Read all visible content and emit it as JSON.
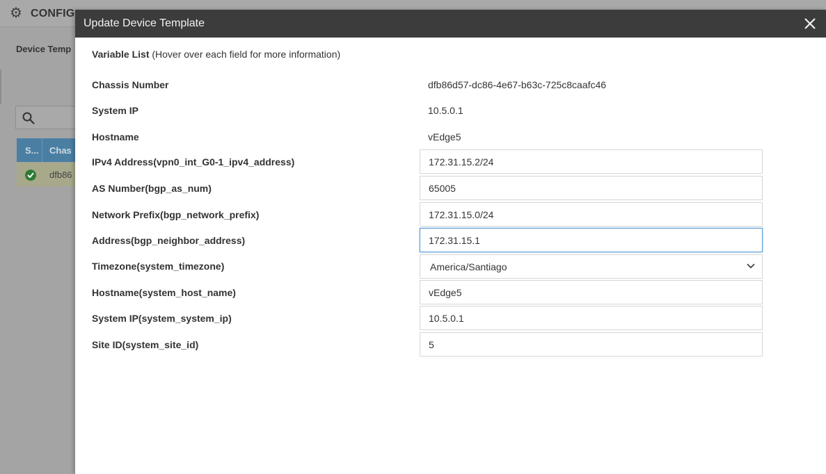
{
  "background": {
    "title": "CONFIG",
    "subtitle": "Device Temp",
    "table": {
      "headers": [
        "S...",
        "Chas"
      ],
      "row_value": "dfb86"
    }
  },
  "modal": {
    "title": "Update Device Template",
    "heading_bold": "Variable List",
    "heading_note": " (Hover over each field for more information)",
    "static_rows": [
      {
        "label": "Chassis Number",
        "value": "dfb86d57-dc86-4e67-b63c-725c8caafc46"
      },
      {
        "label": "System IP",
        "value": "10.5.0.1"
      },
      {
        "label": "Hostname",
        "value": "vEdge5"
      }
    ],
    "fields": [
      {
        "label": "IPv4 Address(vpn0_int_G0-1_ipv4_address)",
        "value": "172.31.15.2/24"
      },
      {
        "label": "AS Number(bgp_as_num)",
        "value": "65005"
      },
      {
        "label": "Network Prefix(bgp_network_prefix)",
        "value": "172.31.15.0/24"
      },
      {
        "label": "Address(bgp_neighbor_address)",
        "value": "172.31.15.1"
      },
      {
        "label": "Timezone(system_timezone)",
        "value": "America/Santiago"
      },
      {
        "label": "Hostname(system_host_name)",
        "value": "vEdge5"
      },
      {
        "label": "System IP(system_system_ip)",
        "value": "10.5.0.1"
      },
      {
        "label": "Site ID(system_site_id)",
        "value": "5"
      }
    ]
  }
}
